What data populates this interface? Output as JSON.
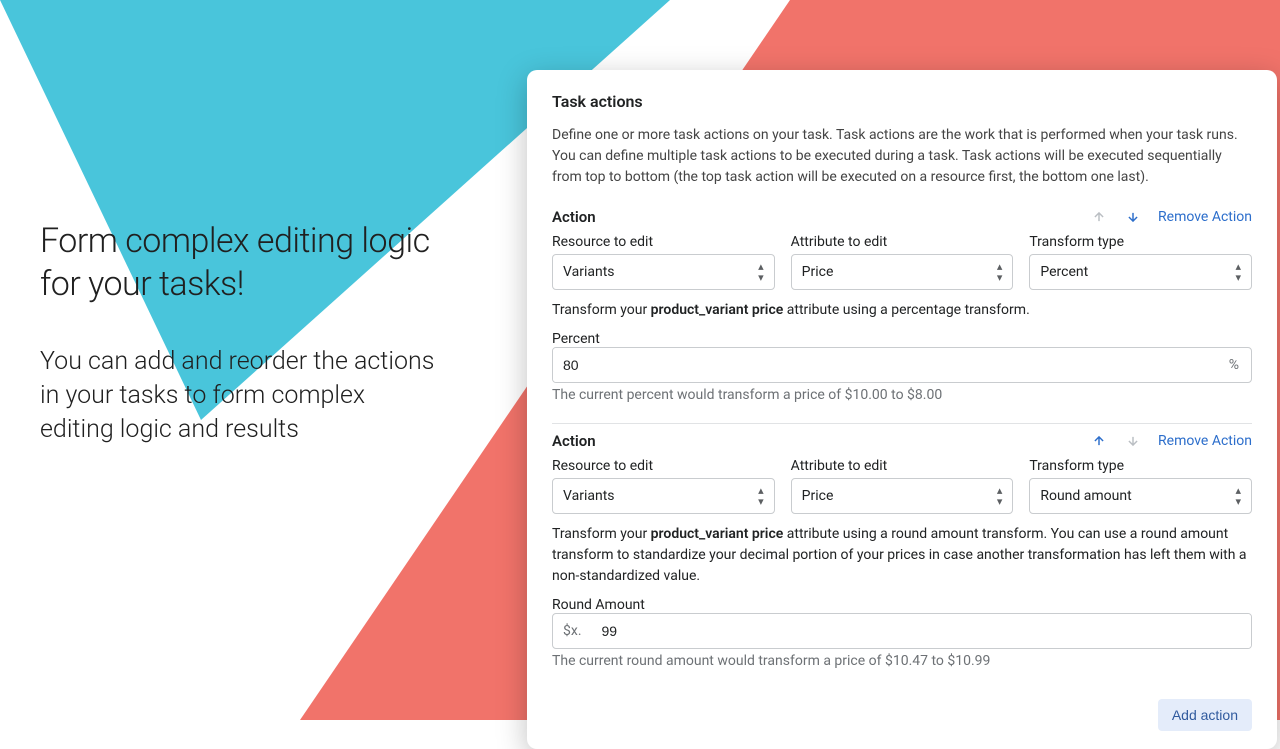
{
  "promo": {
    "title": "Form complex editing logic for your tasks!",
    "body": "You can add and reorder the actions in your tasks to form complex editing logic and results"
  },
  "card": {
    "title": "Task actions",
    "description": "Define one or more task actions on your task. Task actions are the work that is performed when your task runs. You can define multiple task actions to be executed during a task. Task actions will be executed sequentially from top to bottom (the top task action will be executed on a resource first, the bottom one last).",
    "labels": {
      "action": "Action",
      "resource": "Resource to edit",
      "attribute": "Attribute to edit",
      "transform": "Transform type",
      "remove": "Remove Action",
      "add": "Add action"
    },
    "actions": [
      {
        "resource": "Variants",
        "attribute": "Price",
        "transform": "Percent",
        "note_pre": "Transform your ",
        "note_bold": "product_variant price",
        "note_post": " attribute using a percentage transform.",
        "input_label": "Percent",
        "value": "80",
        "suffix": "%",
        "hint": "The current percent would transform a price of $10.00 to $8.00"
      },
      {
        "resource": "Variants",
        "attribute": "Price",
        "transform": "Round amount",
        "note_pre": "Transform your ",
        "note_bold": "product_variant price",
        "note_post": " attribute using a round amount transform. You can use a round amount transform to standardize your decimal portion of your prices in case another transformation has left them with a non-standardized value.",
        "input_label": "Round Amount",
        "prefix": "$x.",
        "value": "99",
        "hint": "The current round amount would transform a price of $10.47 to $10.99"
      }
    ]
  }
}
